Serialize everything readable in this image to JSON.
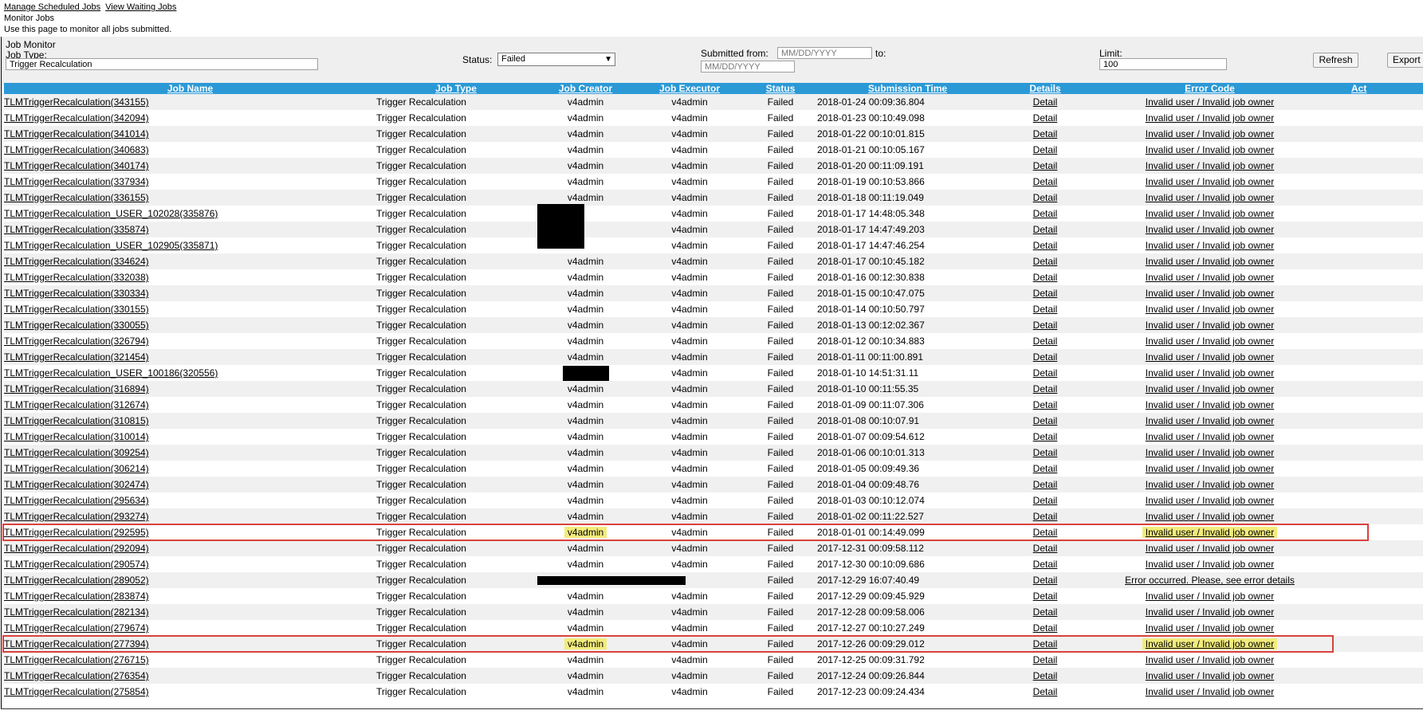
{
  "nav": {
    "link1": "Manage Scheduled Jobs",
    "link2": "View Waiting Jobs"
  },
  "subtitle": "Monitor Jobs",
  "description": "Use this page to monitor all jobs submitted.",
  "panel": {
    "title": "Job Monitor",
    "job_type_label": "Job Type:",
    "job_type_value": "Trigger Recalculation",
    "status_label": "Status:",
    "status_value": "Failed",
    "submitted_from_label": "Submitted from:",
    "from_placeholder": "MM/DD/YYYY",
    "to_label": "to:",
    "to_placeholder": "MM/DD/YYYY",
    "limit_label": "Limit:",
    "limit_value": "100",
    "refresh_label": "Refresh",
    "export_label": "Export"
  },
  "columns": [
    "Job Name",
    "Job Type",
    "Job Creator",
    "Job Executor",
    "Status",
    "Submission Time",
    "Details",
    "Error Code",
    "Act"
  ],
  "rows": [
    {
      "name": "TLMTriggerRecalculation(343155)",
      "type": "Trigger Recalculation",
      "creator": "v4admin",
      "executor": "v4admin",
      "status": "Failed",
      "time": "2018-01-24 00:09:36.804",
      "detail": "Detail",
      "error": "Invalid user / Invalid job owner"
    },
    {
      "name": "TLMTriggerRecalculation(342094)",
      "type": "Trigger Recalculation",
      "creator": "v4admin",
      "executor": "v4admin",
      "status": "Failed",
      "time": "2018-01-23 00:10:49.098",
      "detail": "Detail",
      "error": "Invalid user / Invalid job owner"
    },
    {
      "name": "TLMTriggerRecalculation(341014)",
      "type": "Trigger Recalculation",
      "creator": "v4admin",
      "executor": "v4admin",
      "status": "Failed",
      "time": "2018-01-22 00:10:01.815",
      "detail": "Detail",
      "error": "Invalid user / Invalid job owner"
    },
    {
      "name": "TLMTriggerRecalculation(340683)",
      "type": "Trigger Recalculation",
      "creator": "v4admin",
      "executor": "v4admin",
      "status": "Failed",
      "time": "2018-01-21 00:10:05.167",
      "detail": "Detail",
      "error": "Invalid user / Invalid job owner"
    },
    {
      "name": "TLMTriggerRecalculation(340174)",
      "type": "Trigger Recalculation",
      "creator": "v4admin",
      "executor": "v4admin",
      "status": "Failed",
      "time": "2018-01-20 00:11:09.191",
      "detail": "Detail",
      "error": "Invalid user / Invalid job owner"
    },
    {
      "name": "TLMTriggerRecalculation(337934)",
      "type": "Trigger Recalculation",
      "creator": "v4admin",
      "executor": "v4admin",
      "status": "Failed",
      "time": "2018-01-19 00:10:53.866",
      "detail": "Detail",
      "error": "Invalid user / Invalid job owner"
    },
    {
      "name": "TLMTriggerRecalculation(336155)",
      "type": "Trigger Recalculation",
      "creator": "v4admin",
      "executor": "v4admin",
      "status": "Failed",
      "time": "2018-01-18 00:11:19.049",
      "detail": "Detail",
      "error": "Invalid user / Invalid job owner"
    },
    {
      "name": "TLMTriggerRecalculation_USER_102028(335876)",
      "type": "Trigger Recalculation",
      "creator": "",
      "executor": "v4admin",
      "status": "Failed",
      "time": "2018-01-17 14:48:05.348",
      "detail": "Detail",
      "error": "Invalid user / Invalid job owner",
      "redact": "block"
    },
    {
      "name": "TLMTriggerRecalculation(335874)",
      "type": "Trigger Recalculation",
      "creator": "",
      "executor": "v4admin",
      "status": "Failed",
      "time": "2018-01-17 14:47:49.203",
      "detail": "Detail",
      "error": "Invalid user / Invalid job owner",
      "redact": "block"
    },
    {
      "name": "TLMTriggerRecalculation_USER_102905(335871)",
      "type": "Trigger Recalculation",
      "creator": "",
      "executor": "v4admin",
      "status": "Failed",
      "time": "2018-01-17 14:47:46.254",
      "detail": "Detail",
      "error": "Invalid user / Invalid job owner",
      "redact": "block"
    },
    {
      "name": "TLMTriggerRecalculation(334624)",
      "type": "Trigger Recalculation",
      "creator": "v4admin",
      "executor": "v4admin",
      "status": "Failed",
      "time": "2018-01-17 00:10:45.182",
      "detail": "Detail",
      "error": "Invalid user / Invalid job owner"
    },
    {
      "name": "TLMTriggerRecalculation(332038)",
      "type": "Trigger Recalculation",
      "creator": "v4admin",
      "executor": "v4admin",
      "status": "Failed",
      "time": "2018-01-16 00:12:30.838",
      "detail": "Detail",
      "error": "Invalid user / Invalid job owner"
    },
    {
      "name": "TLMTriggerRecalculation(330334)",
      "type": "Trigger Recalculation",
      "creator": "v4admin",
      "executor": "v4admin",
      "status": "Failed",
      "time": "2018-01-15 00:10:47.075",
      "detail": "Detail",
      "error": "Invalid user / Invalid job owner"
    },
    {
      "name": "TLMTriggerRecalculation(330155)",
      "type": "Trigger Recalculation",
      "creator": "v4admin",
      "executor": "v4admin",
      "status": "Failed",
      "time": "2018-01-14 00:10:50.797",
      "detail": "Detail",
      "error": "Invalid user / Invalid job owner"
    },
    {
      "name": "TLMTriggerRecalculation(330055)",
      "type": "Trigger Recalculation",
      "creator": "v4admin",
      "executor": "v4admin",
      "status": "Failed",
      "time": "2018-01-13 00:12:02.367",
      "detail": "Detail",
      "error": "Invalid user / Invalid job owner"
    },
    {
      "name": "TLMTriggerRecalculation(326794)",
      "type": "Trigger Recalculation",
      "creator": "v4admin",
      "executor": "v4admin",
      "status": "Failed",
      "time": "2018-01-12 00:10:34.883",
      "detail": "Detail",
      "error": "Invalid user / Invalid job owner"
    },
    {
      "name": "TLMTriggerRecalculation(321454)",
      "type": "Trigger Recalculation",
      "creator": "v4admin",
      "executor": "v4admin",
      "status": "Failed",
      "time": "2018-01-11 00:11:00.891",
      "detail": "Detail",
      "error": "Invalid user / Invalid job owner"
    },
    {
      "name": "TLMTriggerRecalculation_USER_100186(320556)",
      "type": "Trigger Recalculation",
      "creator": "",
      "executor": "v4admin",
      "status": "Failed",
      "time": "2018-01-10 14:51:31.11",
      "detail": "Detail",
      "error": "Invalid user / Invalid job owner",
      "redact": "small"
    },
    {
      "name": "TLMTriggerRecalculation(316894)",
      "type": "Trigger Recalculation",
      "creator": "v4admin",
      "executor": "v4admin",
      "status": "Failed",
      "time": "2018-01-10 00:11:55.35",
      "detail": "Detail",
      "error": "Invalid user / Invalid job owner"
    },
    {
      "name": "TLMTriggerRecalculation(312674)",
      "type": "Trigger Recalculation",
      "creator": "v4admin",
      "executor": "v4admin",
      "status": "Failed",
      "time": "2018-01-09 00:11:07.306",
      "detail": "Detail",
      "error": "Invalid user / Invalid job owner"
    },
    {
      "name": "TLMTriggerRecalculation(310815)",
      "type": "Trigger Recalculation",
      "creator": "v4admin",
      "executor": "v4admin",
      "status": "Failed",
      "time": "2018-01-08 00:10:07.91",
      "detail": "Detail",
      "error": "Invalid user / Invalid job owner"
    },
    {
      "name": "TLMTriggerRecalculation(310014)",
      "type": "Trigger Recalculation",
      "creator": "v4admin",
      "executor": "v4admin",
      "status": "Failed",
      "time": "2018-01-07 00:09:54.612",
      "detail": "Detail",
      "error": "Invalid user / Invalid job owner"
    },
    {
      "name": "TLMTriggerRecalculation(309254)",
      "type": "Trigger Recalculation",
      "creator": "v4admin",
      "executor": "v4admin",
      "status": "Failed",
      "time": "2018-01-06 00:10:01.313",
      "detail": "Detail",
      "error": "Invalid user / Invalid job owner"
    },
    {
      "name": "TLMTriggerRecalculation(306214)",
      "type": "Trigger Recalculation",
      "creator": "v4admin",
      "executor": "v4admin",
      "status": "Failed",
      "time": "2018-01-05 00:09:49.36",
      "detail": "Detail",
      "error": "Invalid user / Invalid job owner"
    },
    {
      "name": "TLMTriggerRecalculation(302474)",
      "type": "Trigger Recalculation",
      "creator": "v4admin",
      "executor": "v4admin",
      "status": "Failed",
      "time": "2018-01-04 00:09:48.76",
      "detail": "Detail",
      "error": "Invalid user / Invalid job owner"
    },
    {
      "name": "TLMTriggerRecalculation(295634)",
      "type": "Trigger Recalculation",
      "creator": "v4admin",
      "executor": "v4admin",
      "status": "Failed",
      "time": "2018-01-03 00:10:12.074",
      "detail": "Detail",
      "error": "Invalid user / Invalid job owner"
    },
    {
      "name": "TLMTriggerRecalculation(293274)",
      "type": "Trigger Recalculation",
      "creator": "v4admin",
      "executor": "v4admin",
      "status": "Failed",
      "time": "2018-01-02 00:11:22.527",
      "detail": "Detail",
      "error": "Invalid user / Invalid job owner"
    },
    {
      "name": "TLMTriggerRecalculation(292595)",
      "type": "Trigger Recalculation",
      "creator": "v4admin",
      "executor": "v4admin",
      "status": "Failed",
      "time": "2018-01-01 00:14:49.099",
      "detail": "Detail",
      "error": "Invalid user / Invalid job owner",
      "highlight": true
    },
    {
      "name": "TLMTriggerRecalculation(292094)",
      "type": "Trigger Recalculation",
      "creator": "v4admin",
      "executor": "v4admin",
      "status": "Failed",
      "time": "2017-12-31 00:09:58.112",
      "detail": "Detail",
      "error": "Invalid user / Invalid job owner"
    },
    {
      "name": "TLMTriggerRecalculation(290574)",
      "type": "Trigger Recalculation",
      "creator": "v4admin",
      "executor": "v4admin",
      "status": "Failed",
      "time": "2017-12-30 00:10:09.686",
      "detail": "Detail",
      "error": "Invalid user / Invalid job owner"
    },
    {
      "name": "TLMTriggerRecalculation(289052)",
      "type": "Trigger Recalculation",
      "creator": "",
      "executor": "",
      "status": "Failed",
      "time": "2017-12-29 16:07:40.49",
      "detail": "Detail",
      "error": "Error occurred. Please, see error details",
      "redact": "wide"
    },
    {
      "name": "TLMTriggerRecalculation(283874)",
      "type": "Trigger Recalculation",
      "creator": "v4admin",
      "executor": "v4admin",
      "status": "Failed",
      "time": "2017-12-29 00:09:45.929",
      "detail": "Detail",
      "error": "Invalid user / Invalid job owner"
    },
    {
      "name": "TLMTriggerRecalculation(282134)",
      "type": "Trigger Recalculation",
      "creator": "v4admin",
      "executor": "v4admin",
      "status": "Failed",
      "time": "2017-12-28 00:09:58.006",
      "detail": "Detail",
      "error": "Invalid user / Invalid job owner"
    },
    {
      "name": "TLMTriggerRecalculation(279674)",
      "type": "Trigger Recalculation",
      "creator": "v4admin",
      "executor": "v4admin",
      "status": "Failed",
      "time": "2017-12-27 00:10:27.249",
      "detail": "Detail",
      "error": "Invalid user / Invalid job owner"
    },
    {
      "name": "TLMTriggerRecalculation(277394)",
      "type": "Trigger Recalculation",
      "creator": "v4admin",
      "executor": "v4admin",
      "status": "Failed",
      "time": "2017-12-26 00:09:29.012",
      "detail": "Detail",
      "error": "Invalid user / Invalid job owner",
      "highlight": true
    },
    {
      "name": "TLMTriggerRecalculation(276715)",
      "type": "Trigger Recalculation",
      "creator": "v4admin",
      "executor": "v4admin",
      "status": "Failed",
      "time": "2017-12-25 00:09:31.792",
      "detail": "Detail",
      "error": "Invalid user / Invalid job owner"
    },
    {
      "name": "TLMTriggerRecalculation(276354)",
      "type": "Trigger Recalculation",
      "creator": "v4admin",
      "executor": "v4admin",
      "status": "Failed",
      "time": "2017-12-24 00:09:26.844",
      "detail": "Detail",
      "error": "Invalid user / Invalid job owner"
    },
    {
      "name": "TLMTriggerRecalculation(275854)",
      "type": "Trigger Recalculation",
      "creator": "v4admin",
      "executor": "v4admin",
      "status": "Failed",
      "time": "2017-12-23 00:09:24.434",
      "detail": "Detail",
      "error": "Invalid user / Invalid job owner"
    }
  ],
  "colors": {
    "header_bg": "#2b99d6",
    "row_alt": "#f0f0f0",
    "highlight": "#f2ec7c",
    "annotation_box": "#d9423d"
  }
}
